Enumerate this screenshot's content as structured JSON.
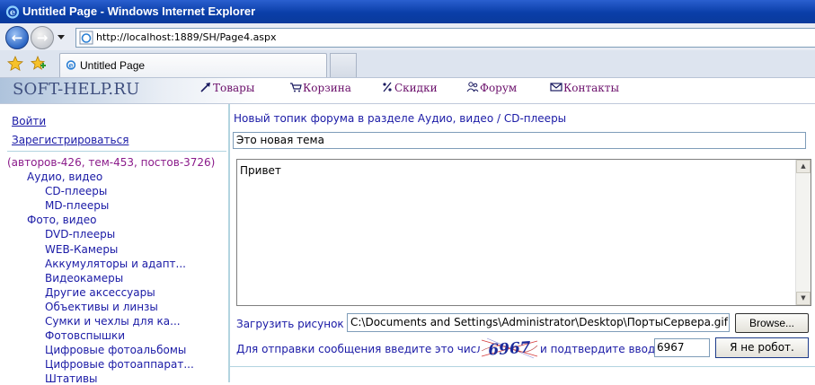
{
  "window": {
    "title": "Untitled Page - Windows Internet Explorer",
    "address": "http://localhost:1889/SH/Page4.aspx",
    "tab_title": "Untitled Page"
  },
  "site": {
    "logo": "SOFT-HELP.RU",
    "nav": [
      {
        "label": "Товары",
        "icon": "arrow-icon"
      },
      {
        "label": "Корзина",
        "icon": "cart-icon"
      },
      {
        "label": "Скидки",
        "icon": "percent-icon"
      },
      {
        "label": "Форум",
        "icon": "people-icon"
      },
      {
        "label": "Контакты",
        "icon": "envelope-icon"
      }
    ]
  },
  "sidebar": {
    "login": "Войти",
    "register": "Зарегистрироваться",
    "stats": "(авторов-426, тем-453, постов-3726)",
    "categories": [
      {
        "label": "Аудио, видео",
        "level": 1
      },
      {
        "label": "CD-плееры",
        "level": 2
      },
      {
        "label": "MD-плееры",
        "level": 2
      },
      {
        "label": "Фото, видео",
        "level": 1
      },
      {
        "label": "DVD-плееры",
        "level": 2
      },
      {
        "label": "WEB-Камеры",
        "level": 2
      },
      {
        "label": "Аккумуляторы и адапт...",
        "level": 2
      },
      {
        "label": "Видеокамеры",
        "level": 2
      },
      {
        "label": "Другие аксессуары",
        "level": 2
      },
      {
        "label": "Объективы и линзы",
        "level": 2
      },
      {
        "label": "Сумки и чехлы для ка...",
        "level": 2
      },
      {
        "label": "Фотовспышки",
        "level": 2
      },
      {
        "label": "Цифровые фотоальбомы",
        "level": 2
      },
      {
        "label": "Цифровые фотоаппарат...",
        "level": 2
      },
      {
        "label": "Штативы",
        "level": 2
      }
    ]
  },
  "form": {
    "heading": "Новый топик форума в разделе Аудио, видео / CD-плееры",
    "subject": "Это новая тема",
    "message": "Привет",
    "upload_label": "Загрузить рисунок -",
    "file_path": "C:\\Documents and Settings\\Administrator\\Desktop\\ПортыСервера.gif",
    "browse": "Browse...",
    "captcha_label": "Для отправки сообщения введите это число:",
    "captcha_value": "6967",
    "captcha_confirm": "и подтвердите ввод:",
    "captcha_input": "6967",
    "submit": "Я не робот."
  },
  "colors": {
    "link": "#1a1aa6",
    "nav": "#6a0e6a",
    "stats": "#8a1a8a",
    "titlebar": "#0a3ea8",
    "separator": "#b3d4e0"
  }
}
